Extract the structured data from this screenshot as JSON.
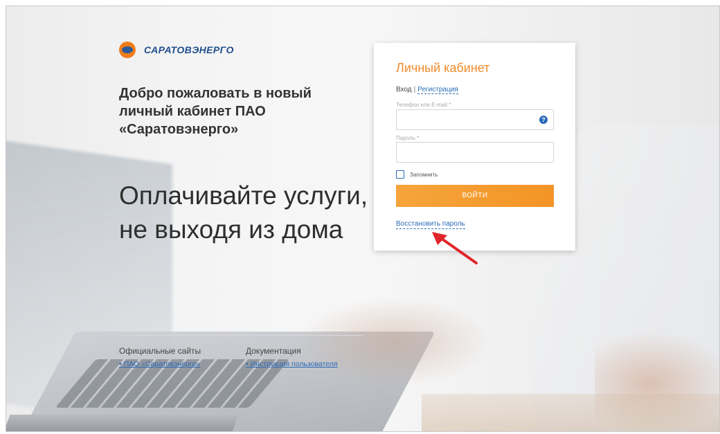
{
  "brand": {
    "name": "САРАТОВЭНЕРГО",
    "accent": "#f08c2a",
    "link_color": "#2a6ab8"
  },
  "left": {
    "welcome": "Добро пожаловать в новый личный кабинет ПАО «Саратовэнерго»",
    "slogan": "Оплачивайте услуги, не выходя из дома"
  },
  "footer": {
    "sites_title": "Официальные сайты",
    "sites_link": "• ПАО «Саратовэнерго»",
    "docs_title": "Документация",
    "docs_link": "• Инструкция пользователя"
  },
  "login": {
    "title": "Личный кабинет",
    "tab_login": "Вход",
    "tab_separator": "|",
    "tab_register": "Регистрация",
    "phone_label": "Телефон или E-mail *",
    "phone_value": "",
    "help_icon": "?",
    "password_label": "Пароль *",
    "password_value": "",
    "remember_label": "Запомнить",
    "submit_label": "ВОЙТИ",
    "forgot_label": "Восстановить пароль"
  },
  "annotation": {
    "arrow_color": "#e0262a",
    "icon": "arrow-icon"
  }
}
